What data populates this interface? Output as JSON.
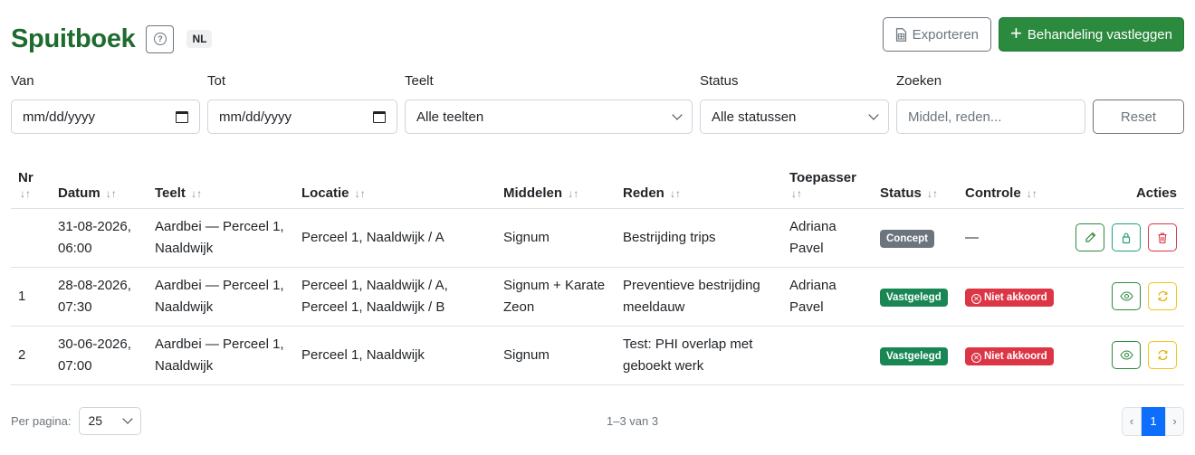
{
  "header": {
    "title": "Spuitboek",
    "help_icon": "question-circle-icon",
    "lang": "NL",
    "export_label": "Exporteren",
    "add_label": "Behandeling vastleggen"
  },
  "filters": {
    "van_label": "Van",
    "van_value": "mm/dd/yyyy",
    "tot_label": "Tot",
    "tot_value": "mm/dd/yyyy",
    "teelt_label": "Teelt",
    "teelt_value": "Alle teelten",
    "status_label": "Status",
    "status_value": "Alle statussen",
    "zoeken_label": "Zoeken",
    "zoeken_placeholder": "Middel, reden...",
    "reset_label": "Reset"
  },
  "table": {
    "headers": {
      "nr": "Nr",
      "datum": "Datum",
      "teelt": "Teelt",
      "locatie": "Locatie",
      "middelen": "Middelen",
      "reden": "Reden",
      "toepasser": "Toepasser",
      "status": "Status",
      "controle": "Controle",
      "acties": "Acties"
    },
    "sort_glyph": "↓↑",
    "rows": [
      {
        "nr": "",
        "datum": "31-08-2026, 06:00",
        "teelt": "Aardbei — Perceel 1, Naaldwijk",
        "locatie": "Perceel 1, Naaldwijk / A",
        "middelen": "Signum",
        "reden": "Bestrijding trips",
        "toepasser": "Adriana Pavel",
        "status": "Concept",
        "controle": "—"
      },
      {
        "nr": "1",
        "datum": "28-08-2026, 07:30",
        "teelt": "Aardbei — Perceel 1, Naaldwijk",
        "locatie": "Perceel 1, Naaldwijk / A, Perceel 1, Naaldwijk / B",
        "middelen": "Signum + Karate Zeon",
        "reden": "Preventieve bestrijding meeldauw",
        "toepasser": "Adriana Pavel",
        "status": "Vastgelegd",
        "controle": "Niet akkoord"
      },
      {
        "nr": "2",
        "datum": "30-06-2026, 07:00",
        "teelt": "Aardbei — Perceel 1, Naaldwijk",
        "locatie": "Perceel 1, Naaldwijk",
        "middelen": "Signum",
        "reden": "Test: PHI overlap met geboekt werk",
        "toepasser": "",
        "status": "Vastgelegd",
        "controle": "Niet akkoord"
      }
    ]
  },
  "footer": {
    "per_page_label": "Per pagina:",
    "per_page_value": "25",
    "range_text": "1–3 van 3",
    "prev": "‹",
    "current_page": "1",
    "next": "›"
  },
  "colors": {
    "brand_green": "#2b8a3e",
    "title_green": "#1e6b2f",
    "status_concept": "#6c757d",
    "status_vastgelegd": "#198754",
    "controle_niet_akkoord": "#dc3545",
    "page_active": "#0d6efd"
  }
}
